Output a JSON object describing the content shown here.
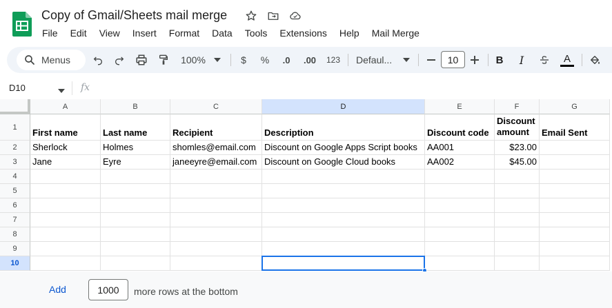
{
  "document": {
    "title": "Copy of Gmail/Sheets mail merge"
  },
  "menu": [
    "File",
    "Edit",
    "View",
    "Insert",
    "Format",
    "Data",
    "Tools",
    "Extensions",
    "Help",
    "Mail Merge"
  ],
  "toolbar": {
    "search_label": "Menus",
    "zoom": "100%",
    "currency": "$",
    "percent": "%",
    "decrease_decimals": ".0",
    "increase_decimals": ".00",
    "number_format": "123",
    "font": "Defaul...",
    "font_size": "10",
    "bold": "B",
    "italic": "I",
    "text_color_glyph": "A"
  },
  "formula_bar": {
    "name_box": "D10",
    "fx": "fx"
  },
  "sheet": {
    "columns": [
      "A",
      "B",
      "C",
      "D",
      "E",
      "F",
      "G"
    ],
    "rows": [
      "1",
      "2",
      "3",
      "4",
      "5",
      "6",
      "7",
      "8",
      "9",
      "10"
    ],
    "selected_cell": "D10",
    "header_row": [
      "First name",
      "Last name",
      "Recipient",
      "Description",
      "Discount code",
      "Discount amount",
      "Email Sent"
    ],
    "data_rows": [
      [
        "Sherlock",
        "Holmes",
        "shomles@email.com",
        "Discount on Google Apps Script books",
        "AA001",
        "$23.00",
        ""
      ],
      [
        "Jane",
        "Eyre",
        "janeeyre@email.com",
        "Discount on Google Cloud books",
        "AA002",
        "$45.00",
        ""
      ]
    ]
  },
  "add_rows": {
    "button": "Add",
    "count": "1000",
    "suffix": "more rows at the bottom"
  },
  "colors": {
    "accent": "#1a73e8",
    "sheets_green": "#0f9d58",
    "toolbar_bg": "#f0f4f9",
    "selected_header": "#d3e3fd"
  }
}
